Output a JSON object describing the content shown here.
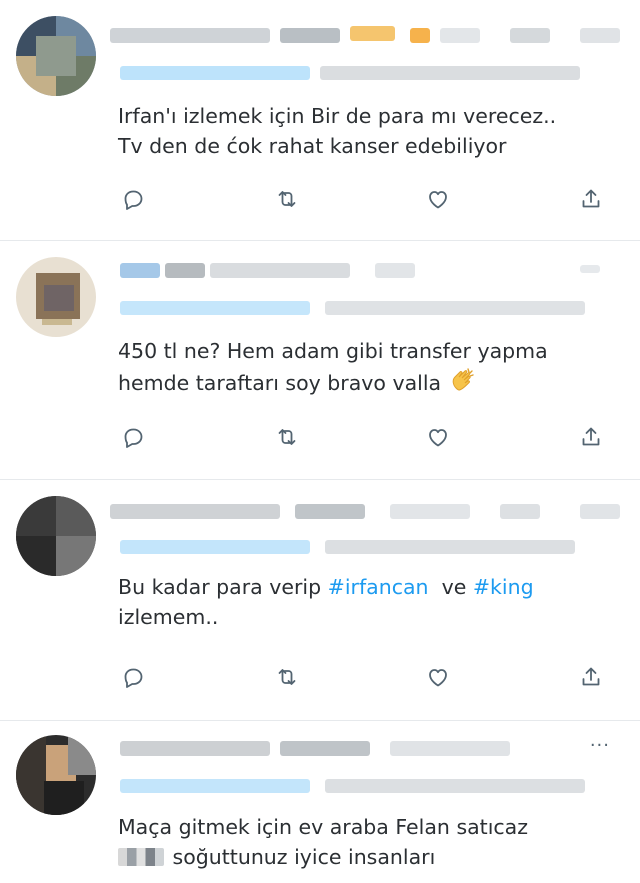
{
  "tweets": [
    {
      "text": "Irfan'ı izlemek için Bir de para mı verecez..\nTv den de ćok rahat kanser edebiliyor",
      "avatar_colors": [
        "#3d4f63",
        "#8a9aa8",
        "#c4b089",
        "#6e7b67"
      ]
    },
    {
      "text_before_emoji": "450 tl ne? Hem adam gibi transfer yapma\nhemde taraftarı soy bravo valla ",
      "emoji_icon": "clapping-hands-icon",
      "avatar_colors": [
        "#e8e0d2",
        "#7d6b57",
        "#a89b7c",
        "#5e5a6e"
      ]
    },
    {
      "text_part1": "Bu kadar para verip ",
      "hashtag1": "#irfancan",
      "text_part2": "  ve ",
      "hashtag2": "#king",
      "text_part3": "\nizlemem..",
      "avatar_colors": [
        "#3a3a3a",
        "#5a5a5a",
        "#2a2a2a",
        "#777777"
      ]
    },
    {
      "text_line1": "Maça gitmek için ev araba Felan satıcaz",
      "text_line2": " soğuttunuz iyice insanları",
      "more_label": "···",
      "avatar_colors": [
        "#2c2c2c",
        "#c9a27a",
        "#4a4a4a",
        "#8a8a8a"
      ]
    }
  ],
  "actions": [
    "reply-icon",
    "retweet-icon",
    "like-icon",
    "share-icon"
  ],
  "colors": {
    "accent": "#1d9bf0",
    "icon": "#536471",
    "text": "#2b2f33",
    "separator": "#e6e9ec"
  }
}
